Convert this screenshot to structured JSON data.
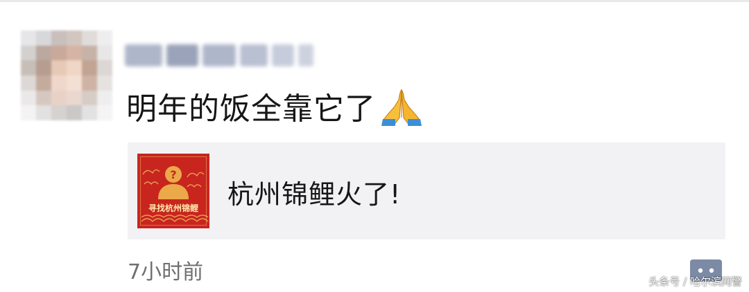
{
  "post": {
    "text": "明年的饭全靠它了",
    "emoji_icon": "folded-hands-icon"
  },
  "shared_link": {
    "thumbnail_caption": "寻找杭州锦鲤",
    "title": "杭州锦鲤火了!"
  },
  "meta": {
    "timestamp": "7小时前",
    "comment_icon": "comment-dots-icon"
  },
  "watermark": {
    "text": "头条号 / 哈尔滨网警"
  },
  "colors": {
    "card_background": "#f2f2f4",
    "thumbnail_red": "#c8251f",
    "timestamp_gray": "#6f6f6f",
    "comment_button_blue": "#7c8aa6"
  }
}
